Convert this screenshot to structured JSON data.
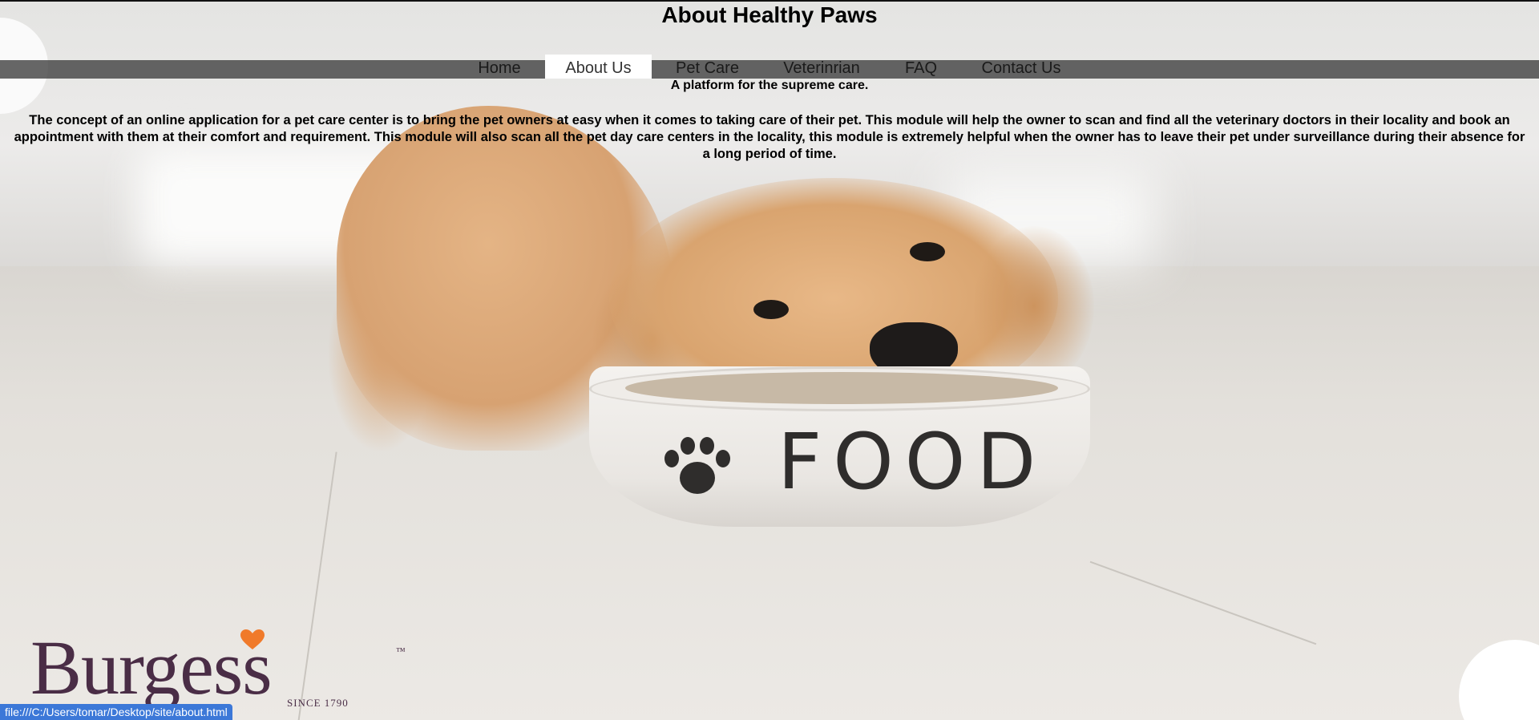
{
  "header": {
    "title": "About Healthy Paws"
  },
  "nav": {
    "items": [
      {
        "label": "Home"
      },
      {
        "label": "About Us"
      },
      {
        "label": "Pet Care"
      },
      {
        "label": "Veterinrian"
      },
      {
        "label": "FAQ"
      },
      {
        "label": "Contact Us"
      }
    ],
    "active": "About Us"
  },
  "content": {
    "tagline": "A platform for the supreme care.",
    "description": "The concept of an online application for a pet care center is to bring the pet owners at easy when it comes to taking care of their pet. This module will help the owner to scan and find all the veterinary doctors in their locality and book an appointment with them at their comfort and requirement. This module will also scan all the pet day care centers in the locality, this module is extremely helpful when the owner has to leave their pet under surveillance during their absence for a long period of time."
  },
  "background": {
    "bowl_text": "FOOD"
  },
  "logo": {
    "name": "Burgess",
    "trademark": "™",
    "since": "SINCE 1790"
  },
  "status_bar": {
    "url": "file:///C:/Users/tomar/Desktop/site/about.html"
  },
  "colors": {
    "nav_bar": "#3c3c3c",
    "active_tab": "#ffffff",
    "logo": "#4a2d46",
    "logo_accent": "#f07a2a",
    "status_bar": "#3c78d8"
  }
}
